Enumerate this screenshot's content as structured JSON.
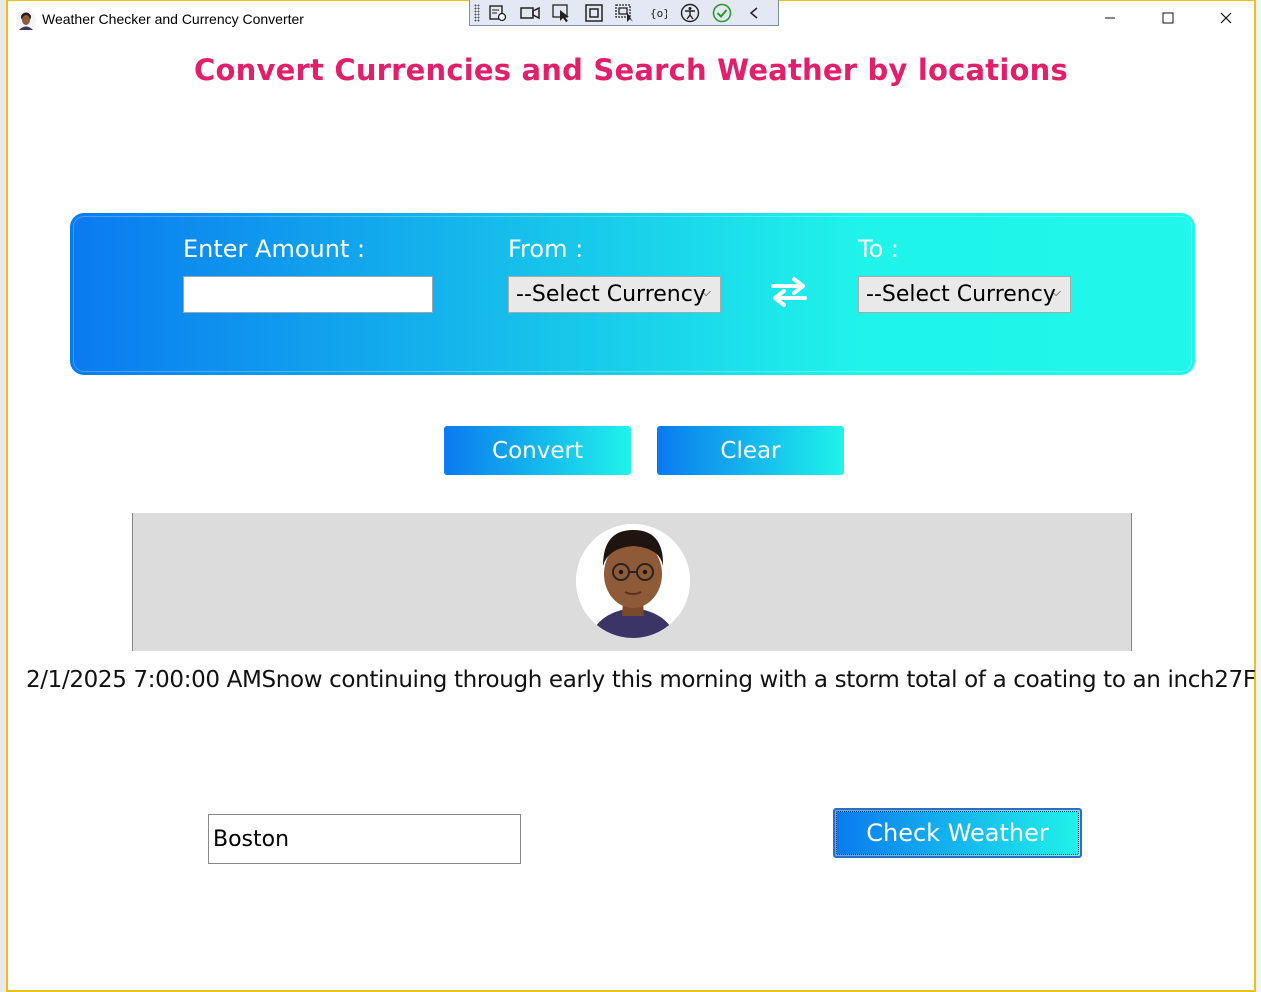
{
  "window": {
    "title": "Weather Checker and Currency Converter"
  },
  "page": {
    "heading": "Convert Currencies and Search Weather by locations"
  },
  "converter": {
    "amount_label": "Enter Amount :",
    "amount_value": "",
    "from_label": "From :",
    "from_selected": "--Select Currency",
    "to_label": "To :",
    "to_selected": "--Select Currency"
  },
  "actions": {
    "convert_label": "Convert",
    "clear_label": "Clear"
  },
  "weather": {
    "result_text": "2/1/2025 7:00:00 AMSnow continuing through early this morning with a storm total of a coating to an inch27F",
    "city_value": "Boston",
    "check_label": "Check Weather"
  },
  "colors": {
    "heading": "#e21f6b",
    "gradient_start": "#0a7af0",
    "gradient_end": "#20f3ea",
    "window_border": "#e8c21a"
  },
  "icons": {
    "swap": "swap-arrows-icon",
    "minimize": "minimize-icon",
    "maximize": "maximize-icon",
    "close": "close-icon"
  }
}
